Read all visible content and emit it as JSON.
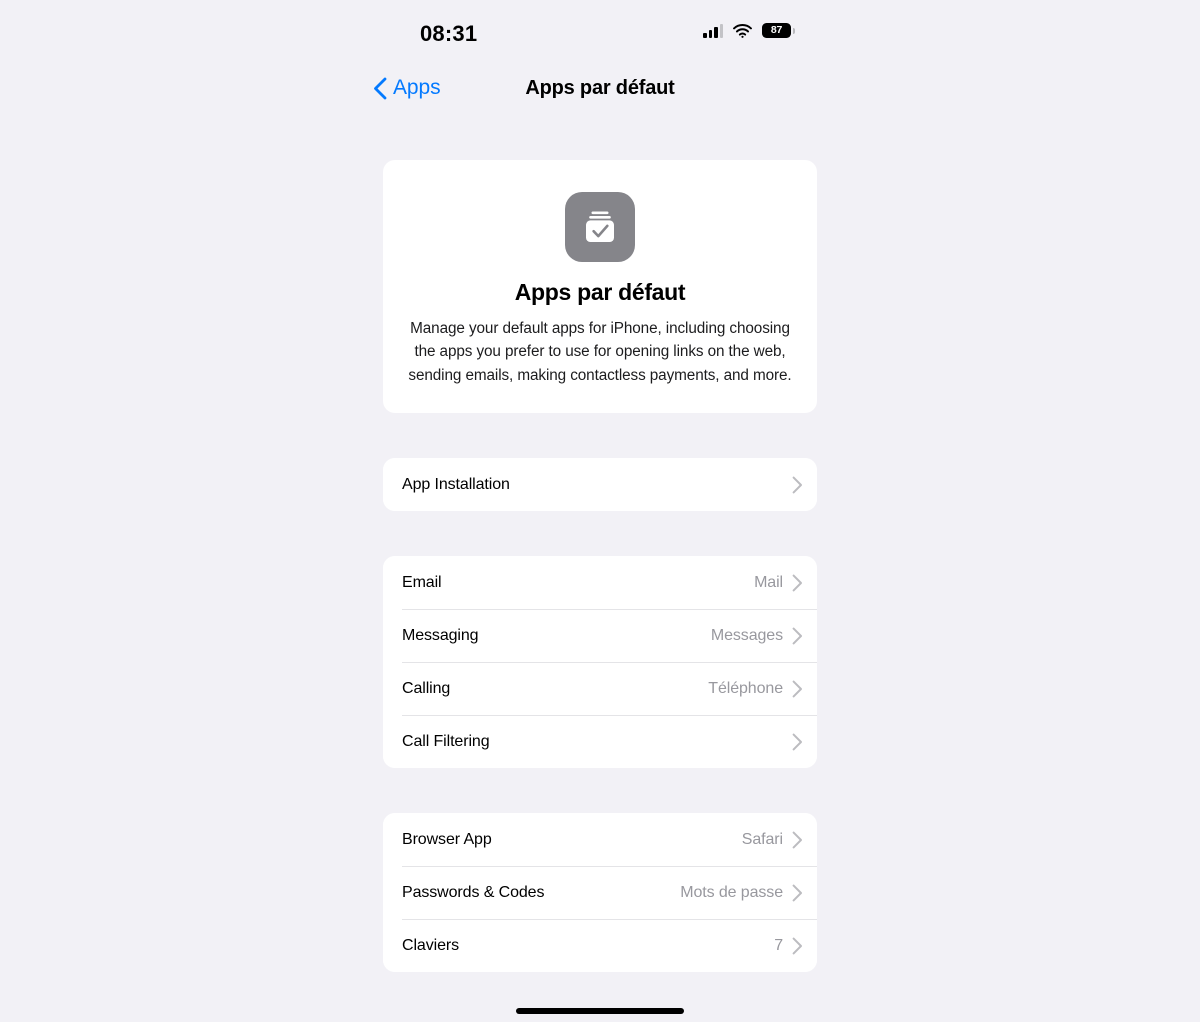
{
  "status_bar": {
    "time": "08:31",
    "cellular_icon": "cellular-bars-icon",
    "wifi_icon": "wifi-icon",
    "battery_icon": "battery-icon",
    "battery_percent": "87"
  },
  "nav": {
    "back_label": "Apps",
    "back_icon": "chevron-left-icon",
    "title": "Apps par défaut"
  },
  "hero": {
    "icon": "default-apps-icon",
    "title": "Apps par défaut",
    "description": "Manage your default apps for iPhone, including choosing the apps you prefer to use for opening links on the web, sending emails, making contactless payments, and more."
  },
  "groups": [
    {
      "rows": [
        {
          "label": "App Installation",
          "value": "",
          "chevron": "chevron-right-icon"
        }
      ]
    },
    {
      "rows": [
        {
          "label": "Email",
          "value": "Mail",
          "chevron": "chevron-right-icon"
        },
        {
          "label": "Messaging",
          "value": "Messages",
          "chevron": "chevron-right-icon"
        },
        {
          "label": "Calling",
          "value": "Téléphone",
          "chevron": "chevron-right-icon"
        },
        {
          "label": "Call Filtering",
          "value": "",
          "chevron": "chevron-right-icon"
        }
      ]
    },
    {
      "rows": [
        {
          "label": "Browser App",
          "value": "Safari",
          "chevron": "chevron-right-icon"
        },
        {
          "label": "Passwords & Codes",
          "value": "Mots de passe",
          "chevron": "chevron-right-icon"
        },
        {
          "label": "Claviers",
          "value": "7",
          "chevron": "chevron-right-icon"
        }
      ]
    }
  ],
  "home_indicator": "home-indicator",
  "colors": {
    "background": "#f2f1f6",
    "card": "#ffffff",
    "accent": "#047aff",
    "secondary_text": "#98989e",
    "separator": "#e4e4e7",
    "icon_gray": "#85858a"
  }
}
